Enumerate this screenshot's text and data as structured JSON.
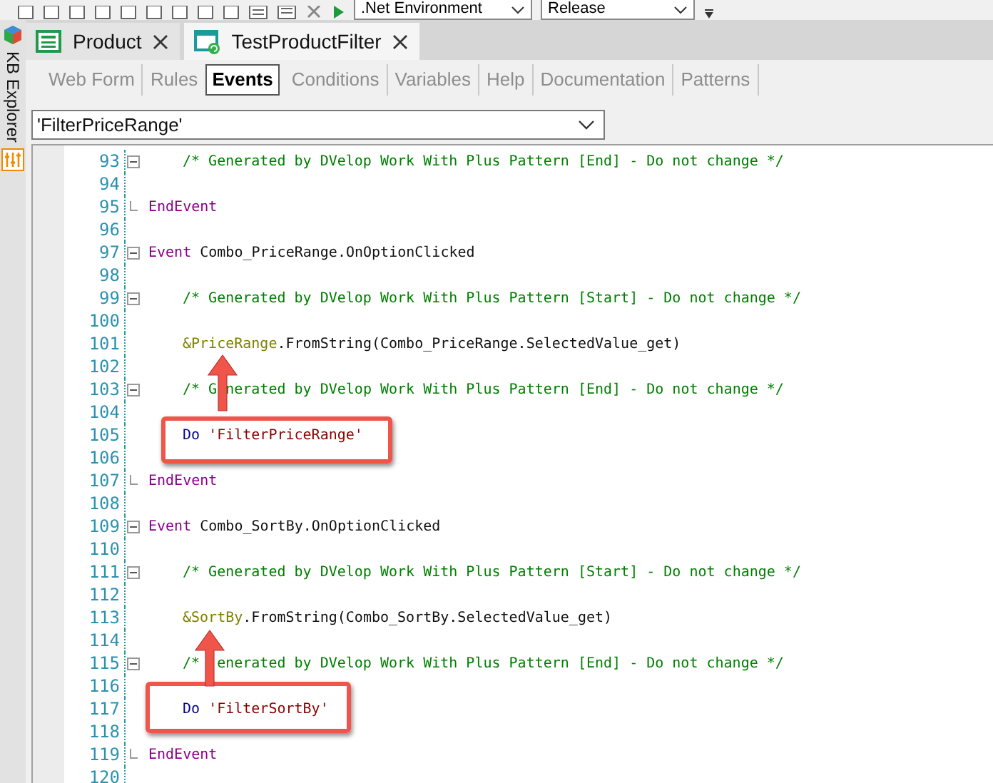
{
  "toolbar": {
    "environment": ".Net Environment",
    "configuration": "Release"
  },
  "sidebar": {
    "label": "KB Explorer"
  },
  "document_tabs": [
    {
      "label": "Product",
      "kind": "table",
      "selected": false
    },
    {
      "label": "TestProductFilter",
      "kind": "panel",
      "selected": true
    }
  ],
  "part_tabs": [
    {
      "label": "Web Form",
      "selected": false
    },
    {
      "label": "Rules",
      "selected": false
    },
    {
      "label": "Events",
      "selected": true
    },
    {
      "label": "Conditions",
      "selected": false
    },
    {
      "label": "Variables",
      "selected": false
    },
    {
      "label": "Help",
      "selected": false
    },
    {
      "label": "Documentation",
      "selected": false
    },
    {
      "label": "Patterns",
      "selected": false
    }
  ],
  "event_selector": {
    "value": "'FilterPriceRange'"
  },
  "code": {
    "lines": [
      {
        "number": "93",
        "collapsible": true,
        "block_end": false,
        "indented": true,
        "tokens": [
          {
            "kind": "comment",
            "text": "/* Generated by DVelop Work With Plus Pattern [End] - Do not change */"
          }
        ]
      },
      {
        "number": "94",
        "collapsible": false,
        "block_end": false
      },
      {
        "number": "95",
        "collapsible": false,
        "block_end": true,
        "indented": false,
        "tokens": [
          {
            "kind": "keyword",
            "text": "EndEvent"
          }
        ]
      },
      {
        "number": "96",
        "collapsible": false,
        "block_end": false
      },
      {
        "number": "97",
        "collapsible": true,
        "block_end": false,
        "indented": false,
        "tokens": [
          {
            "kind": "keyword",
            "text": "Event"
          },
          {
            "kind": "space"
          },
          {
            "kind": "plain",
            "text": "Combo_PriceRange.OnOptionClicked"
          }
        ]
      },
      {
        "number": "98",
        "collapsible": false,
        "block_end": false
      },
      {
        "number": "99",
        "collapsible": true,
        "block_end": false,
        "indented": true,
        "tokens": [
          {
            "kind": "comment",
            "text": "/* Generated by DVelop Work With Plus Pattern [Start] - Do not change */"
          }
        ]
      },
      {
        "number": "100",
        "collapsible": false,
        "block_end": false
      },
      {
        "number": "101",
        "collapsible": false,
        "block_end": false,
        "indented": true,
        "tokens": [
          {
            "kind": "variable",
            "text": "&PriceRange"
          },
          {
            "kind": "plain",
            "text": ".FromString(Combo_PriceRange.SelectedValue_get)"
          }
        ]
      },
      {
        "number": "102",
        "collapsible": false,
        "block_end": false
      },
      {
        "number": "103",
        "collapsible": true,
        "block_end": false,
        "indented": true,
        "tokens": [
          {
            "kind": "comment",
            "text": "/* G"
          },
          {
            "kind": "space"
          },
          {
            "kind": "comment",
            "text": "nerated by DVelop Work With Plus Pattern [End] - Do not change */"
          }
        ]
      },
      {
        "number": "104",
        "collapsible": false,
        "block_end": false
      },
      {
        "number": "105",
        "collapsible": false,
        "block_end": false,
        "indented": true,
        "tokens": [
          {
            "kind": "command",
            "text": "Do"
          },
          {
            "kind": "space"
          },
          {
            "kind": "string",
            "text": "'FilterPriceRange'"
          }
        ]
      },
      {
        "number": "106",
        "collapsible": false,
        "block_end": false
      },
      {
        "number": "107",
        "collapsible": false,
        "block_end": true,
        "indented": false,
        "tokens": [
          {
            "kind": "keyword",
            "text": "EndEvent"
          }
        ]
      },
      {
        "number": "108",
        "collapsible": false,
        "block_end": false
      },
      {
        "number": "109",
        "collapsible": true,
        "block_end": false,
        "indented": false,
        "tokens": [
          {
            "kind": "keyword",
            "text": "Event"
          },
          {
            "kind": "space"
          },
          {
            "kind": "plain",
            "text": "Combo_SortBy.OnOptionClicked"
          }
        ]
      },
      {
        "number": "110",
        "collapsible": false,
        "block_end": false
      },
      {
        "number": "111",
        "collapsible": true,
        "block_end": false,
        "indented": true,
        "tokens": [
          {
            "kind": "comment",
            "text": "/* Generated by DVelop Work With Plus Pattern [Start] - Do not change */"
          }
        ]
      },
      {
        "number": "112",
        "collapsible": false,
        "block_end": false
      },
      {
        "number": "113",
        "collapsible": false,
        "block_end": false,
        "indented": true,
        "tokens": [
          {
            "kind": "variable",
            "text": "&SortBy"
          },
          {
            "kind": "plain",
            "text": ".FromString(Combo_SortBy.SelectedValue_get)"
          }
        ]
      },
      {
        "number": "114",
        "collapsible": false,
        "block_end": false
      },
      {
        "number": "115",
        "collapsible": true,
        "block_end": false,
        "indented": true,
        "tokens": [
          {
            "kind": "comment",
            "text": "/*"
          },
          {
            "kind": "space"
          },
          {
            "kind": "space"
          },
          {
            "kind": "comment",
            "text": "enerated by DVelop Work With Plus Pattern [End] - Do not change */"
          }
        ]
      },
      {
        "number": "116",
        "collapsible": false,
        "block_end": false
      },
      {
        "number": "117",
        "collapsible": false,
        "block_end": false,
        "indented": true,
        "tokens": [
          {
            "kind": "command",
            "text": "Do"
          },
          {
            "kind": "space"
          },
          {
            "kind": "string",
            "text": "'FilterSortBy'"
          }
        ]
      },
      {
        "number": "118",
        "collapsible": false,
        "block_end": false
      },
      {
        "number": "119",
        "collapsible": false,
        "block_end": true,
        "indented": false,
        "tokens": [
          {
            "kind": "keyword",
            "text": "EndEvent"
          }
        ]
      },
      {
        "number": "120",
        "collapsible": false,
        "block_end": false
      }
    ]
  }
}
